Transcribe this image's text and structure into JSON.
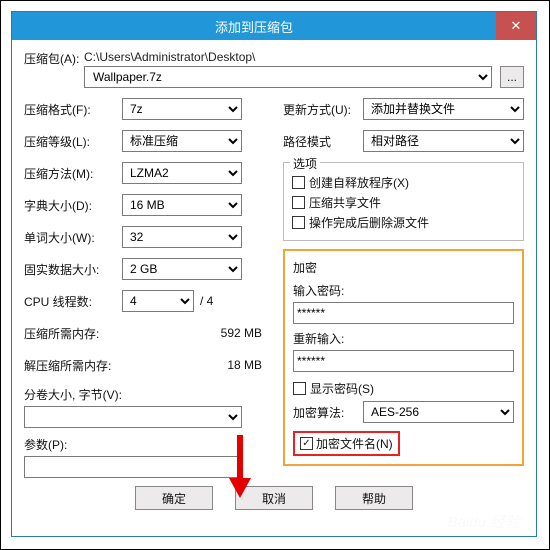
{
  "titlebar": {
    "title": "添加到压缩包",
    "close": "✕"
  },
  "archive": {
    "label": "压缩包(A):",
    "path": "C:\\Users\\Administrator\\Desktop\\",
    "filename": "Wallpaper.7z",
    "browse": "..."
  },
  "left": {
    "format_label": "压缩格式(F):",
    "format_value": "7z",
    "level_label": "压缩等级(L):",
    "level_value": "标准压缩",
    "method_label": "压缩方法(M):",
    "method_value": "LZMA2",
    "dict_label": "字典大小(D):",
    "dict_value": "16 MB",
    "word_label": "单词大小(W):",
    "word_value": "32",
    "solid_label": "固实数据大小:",
    "solid_value": "2 GB",
    "threads_label": "CPU 线程数:",
    "threads_value": "4",
    "threads_total": "/ 4",
    "compmem_label": "压缩所需内存:",
    "compmem_value": "592 MB",
    "decompmem_label": "解压缩所需内存:",
    "decompmem_value": "18 MB",
    "split_label": "分卷大小, 字节(V):",
    "params_label": "参数(P):"
  },
  "right": {
    "update_label": "更新方式(U):",
    "update_value": "添加并替换文件",
    "pathmode_label": "路径模式",
    "pathmode_value": "相对路径",
    "options_title": "选项",
    "opt_sfx": "创建自释放程序(X)",
    "opt_share": "压缩共享文件",
    "opt_delete": "操作完成后删除源文件",
    "enc_title": "加密",
    "enc_pass_label": "输入密码:",
    "enc_pass_value": "******",
    "enc_pass2_label": "重新输入:",
    "enc_pass2_value": "******",
    "enc_show": "显示密码(S)",
    "enc_algo_label": "加密算法:",
    "enc_algo_value": "AES-256",
    "enc_name": "加密文件名(N)"
  },
  "buttons": {
    "ok": "确定",
    "cancel": "取消",
    "help": "帮助"
  }
}
